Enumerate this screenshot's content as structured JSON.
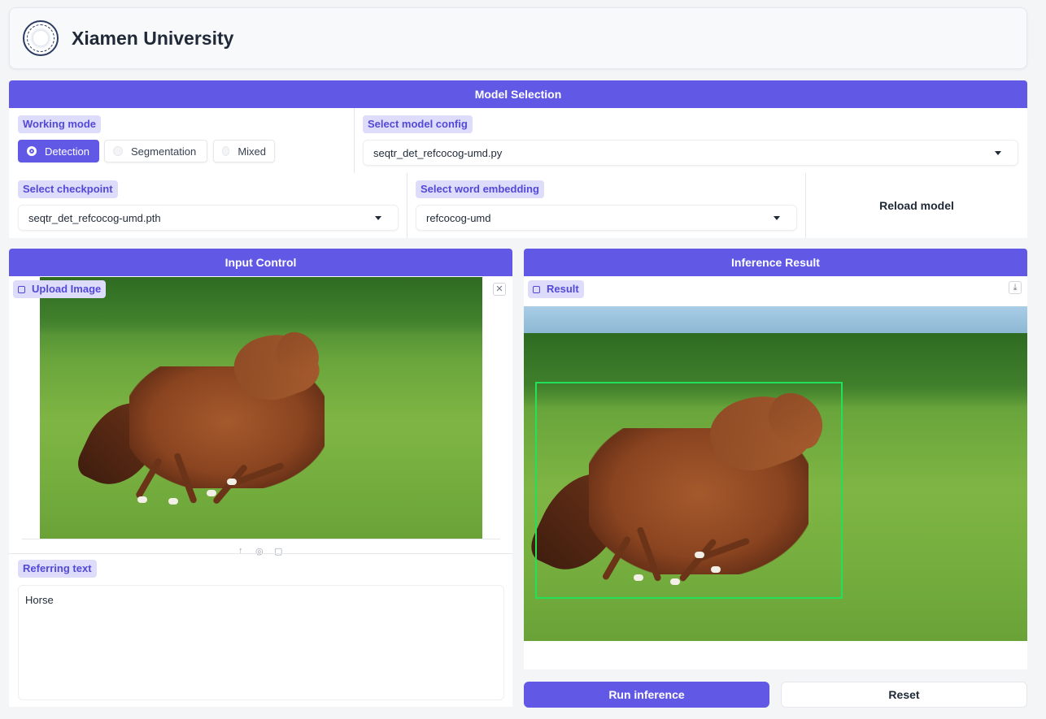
{
  "header": {
    "title": "Xiamen University",
    "logo_icon": "university-seal-icon"
  },
  "model_selection": {
    "title": "Model Selection",
    "working_mode": {
      "label": "Working mode",
      "options": [
        "Detection",
        "Segmentation",
        "Mixed"
      ],
      "selected": "Detection"
    },
    "model_config": {
      "label": "Select model config",
      "value": "seqtr_det_refcocog-umd.py"
    },
    "checkpoint": {
      "label": "Select checkpoint",
      "value": "seqtr_det_refcocog-umd.pth"
    },
    "word_embedding": {
      "label": "Select word embedding",
      "value": "refcocog-umd"
    },
    "reload_label": "Reload model"
  },
  "input_control": {
    "title": "Input Control",
    "upload_label": "Upload Image",
    "referring_label": "Referring text",
    "referring_value": "Horse"
  },
  "inference_result": {
    "title": "Inference Result",
    "result_label": "Result",
    "box_color": "#22e05a"
  },
  "actions": {
    "run_label": "Run inference",
    "reset_label": "Reset"
  },
  "colors": {
    "accent": "#6158e5",
    "chip_bg": "#dedcfb"
  }
}
